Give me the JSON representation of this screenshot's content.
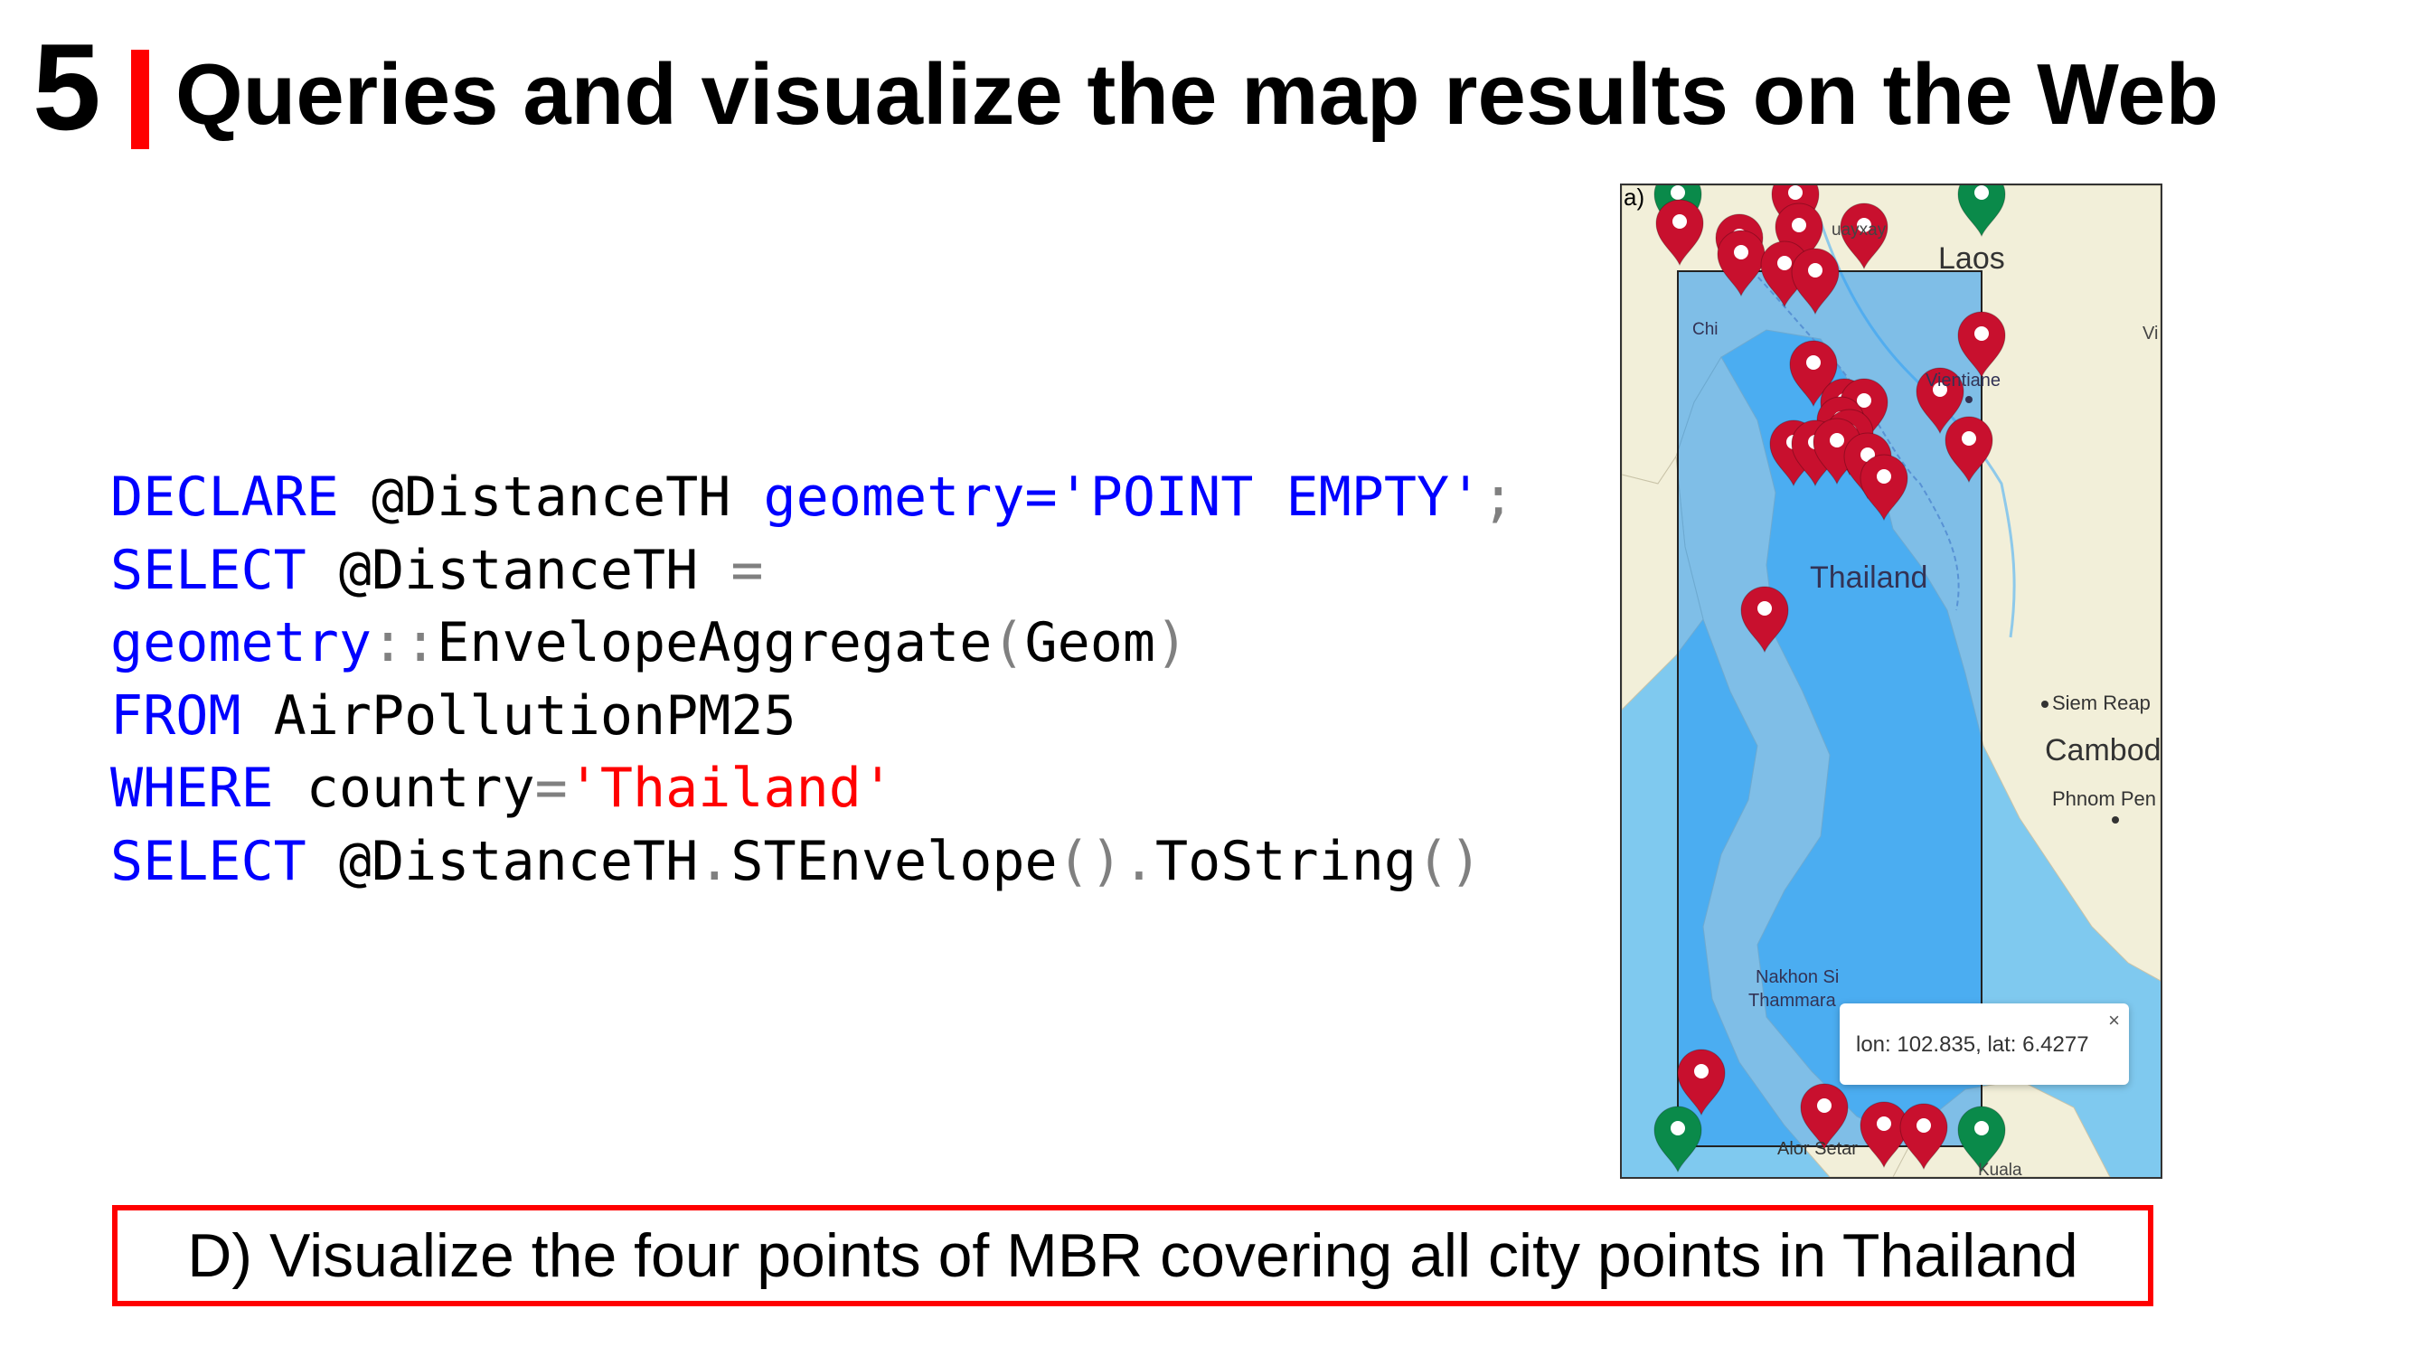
{
  "slide": {
    "number": "5",
    "title": "Queries and visualize the map results on the Web",
    "caption": "D) Visualize the four points of MBR covering all city points in Thailand"
  },
  "code": {
    "line1": {
      "kw1": "DECLARE",
      "var": " @DistanceTH ",
      "kw2": "geometry=",
      "str": "'POINT EMPTY'",
      "end": ";"
    },
    "line2": {
      "kw1": "SELECT",
      "var": " @DistanceTH ",
      "op": "="
    },
    "line3": {
      "kw1": "geometry",
      "op1": "::",
      "fn": "EnvelopeAggregate",
      "op2": "(",
      "arg": "Geom",
      "op3": ")"
    },
    "line4": {
      "kw1": "FROM",
      "rest": " AirPollutionPM25"
    },
    "line5": {
      "kw1": "WHERE",
      "rest": " country",
      "op": "=",
      "str": "'Thailand'"
    },
    "line6": {
      "kw1": "SELECT",
      "var": " @DistanceTH",
      "op1": ".",
      "fn1": "STEnvelope",
      "op2": "().",
      "fn2": "ToString",
      "op3": "()"
    }
  },
  "map": {
    "panel_label": "a)",
    "place_labels": {
      "huayxay": "uayxay",
      "laos": "Laos",
      "chiang": "Chi",
      "vientiane": "Vientiane",
      "vi": "Vi",
      "thailand": "Thailand",
      "siem_reap": "Siem Reap",
      "cambodia": "Cambod",
      "phnom_penh": "Phnom Pen",
      "nakhon": "Nakhon Si",
      "thammarat": "Thammara",
      "alor_setar": "Alor Setar",
      "kuala": "Kuala"
    },
    "popup": {
      "text": "lon: 102.835, lat: 6.4277",
      "close": "×"
    },
    "colors": {
      "city_marker": "#c8102e",
      "mbr_marker": "#0a8a4a",
      "envelope": "#2196f3",
      "land": "#f2efd9",
      "water": "#7fc9ef"
    }
  }
}
